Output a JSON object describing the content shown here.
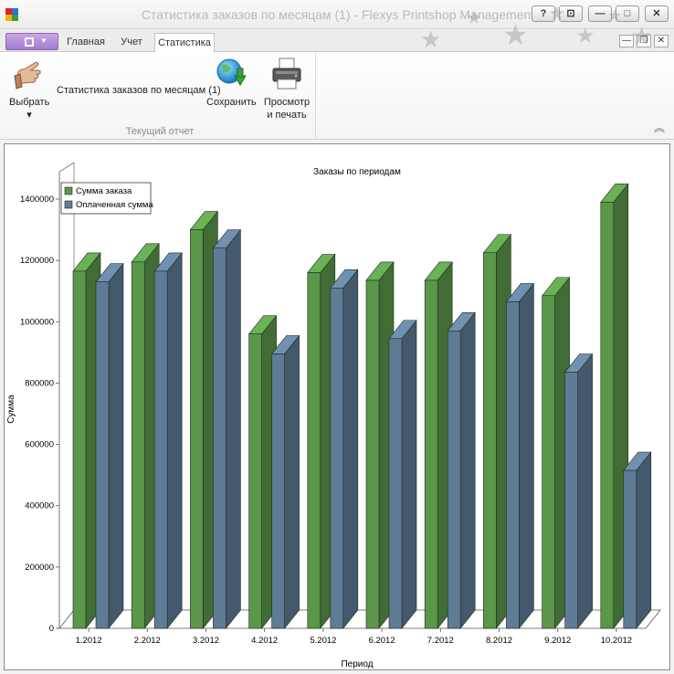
{
  "window": {
    "title": "Статистика заказов по месяцам (1) - Flexys Printshop Management"
  },
  "title_buttons": [
    "?",
    "⊡",
    "—",
    "□",
    "✕"
  ],
  "tabs": [
    {
      "label": "Главная",
      "active": false
    },
    {
      "label": "Учет",
      "active": false
    },
    {
      "label": "Статистика",
      "active": true
    }
  ],
  "mdi_buttons": [
    "—",
    "❐",
    "✕"
  ],
  "ribbon": {
    "select_label": "Выбрать",
    "select_caret": "▾",
    "report_name": "Статистика заказов по месяцам (1)",
    "save_label": "Сохранить",
    "print_line1": "Просмотр",
    "print_line2": "и печать",
    "group_label": "Текущий отчет",
    "collapse": "︽"
  },
  "colors": {
    "series_order": "#5a9748",
    "series_paid": "#5f7b96"
  },
  "chart_data": {
    "type": "bar",
    "title": "Заказы по периодам",
    "xlabel": "Период",
    "ylabel": "Сумма",
    "ylim": [
      0,
      1400000
    ],
    "yticks": [
      0,
      200000,
      400000,
      600000,
      800000,
      1000000,
      1200000,
      1400000
    ],
    "categories": [
      "1.2012",
      "2.2012",
      "3.2012",
      "4.2012",
      "5.2012",
      "6.2012",
      "7.2012",
      "8.2012",
      "9.2012",
      "10.2012"
    ],
    "series": [
      {
        "name": "Сумма заказа",
        "values": [
          1165000,
          1195000,
          1300000,
          960000,
          1160000,
          1135000,
          1135000,
          1225000,
          1085000,
          1390000
        ]
      },
      {
        "name": "Оплаченная сумма",
        "values": [
          1130000,
          1165000,
          1240000,
          895000,
          1110000,
          945000,
          970000,
          1065000,
          835000,
          515000
        ]
      }
    ],
    "legend": "top-left",
    "grid": false
  }
}
